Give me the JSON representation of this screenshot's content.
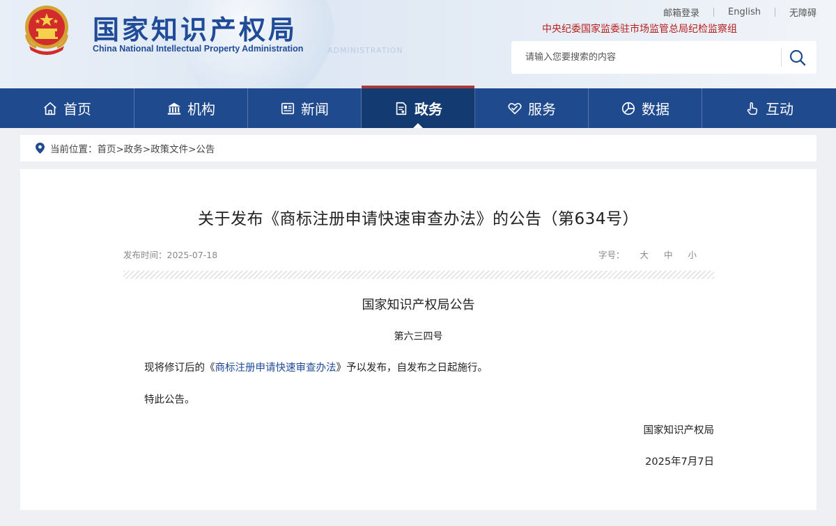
{
  "header": {
    "logo_cn": "国家知识产权局",
    "logo_en": "China National Intellectual Property Administration",
    "watermark": "ADMINISTRATION",
    "top_links": [
      "邮箱登录",
      "English",
      "无障碍"
    ],
    "supervisor": "中央纪委国家监委驻市场监管总局纪检监察组",
    "search_placeholder": "请输入您要搜索的内容"
  },
  "nav": {
    "items": [
      {
        "label": "首页",
        "icon": "home-icon"
      },
      {
        "label": "机构",
        "icon": "institution-icon"
      },
      {
        "label": "新闻",
        "icon": "news-icon"
      },
      {
        "label": "政务",
        "icon": "document-icon",
        "active": true
      },
      {
        "label": "服务",
        "icon": "service-icon"
      },
      {
        "label": "数据",
        "icon": "pie-chart-icon"
      },
      {
        "label": "互动",
        "icon": "hand-icon"
      }
    ]
  },
  "breadcrumb": {
    "prefix": "当前位置：",
    "path": "首页>政务>政策文件>公告"
  },
  "article": {
    "title": "关于发布《商标注册申请快速审查办法》的公告（第634号）",
    "publish_label": "发布时间：",
    "publish_date": "2025-07-18",
    "font_label": "字号：",
    "font_options": [
      "大",
      "中",
      "小"
    ],
    "doc_head": "国家知识产权局公告",
    "doc_no": "第六三四号",
    "para1_before": "现将修订后的《",
    "para1_link": "商标注册申请快速审查办法",
    "para1_after": "》予以发布，自发布之日起施行。",
    "para2": "特此公告。",
    "sign_org": "国家知识产权局",
    "sign_date": "2025年7月7日"
  },
  "colors": {
    "nav_bg": "#1f4a8e",
    "nav_active": "#143a72",
    "brand_blue": "#1f4b98",
    "supervisor_red": "#b51d1d"
  }
}
